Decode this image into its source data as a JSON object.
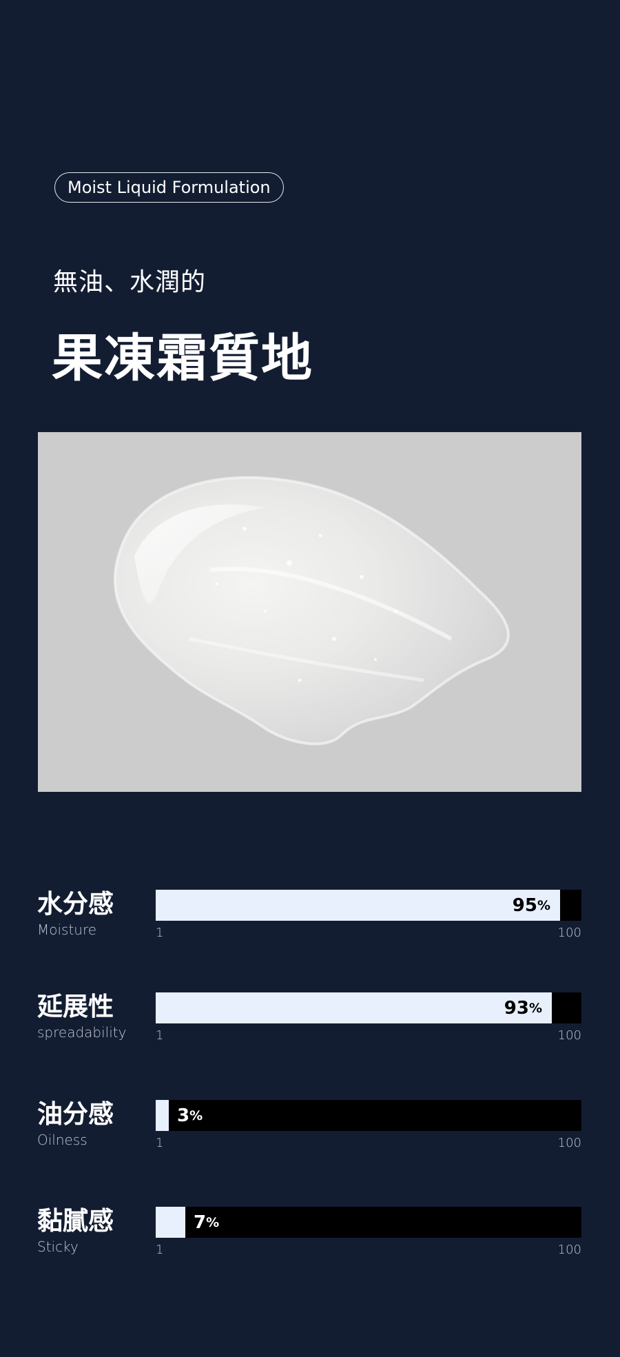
{
  "badge": "Moist Liquid Formulation",
  "subtitle": "無油、水潤的",
  "title": "果凍霜質地",
  "metrics": [
    {
      "ko": "水分感",
      "en": "Moisture",
      "value": 95,
      "value_text": "95",
      "unit": "%",
      "min": "1",
      "max": "100"
    },
    {
      "ko": "延展性",
      "en": "spreadability",
      "value": 93,
      "value_text": "93",
      "unit": "%",
      "min": "1",
      "max": "100"
    },
    {
      "ko": "油分感",
      "en": "Oilness",
      "value": 3,
      "value_text": "3",
      "unit": "%",
      "min": "1",
      "max": "100"
    },
    {
      "ko": "黏膩感",
      "en": "Sticky",
      "value": 7,
      "value_text": "7",
      "unit": "%",
      "min": "1",
      "max": "100"
    }
  ],
  "colors": {
    "background": "#131d32",
    "bar_fill": "#e8f0fd",
    "bar_track": "#000000"
  }
}
